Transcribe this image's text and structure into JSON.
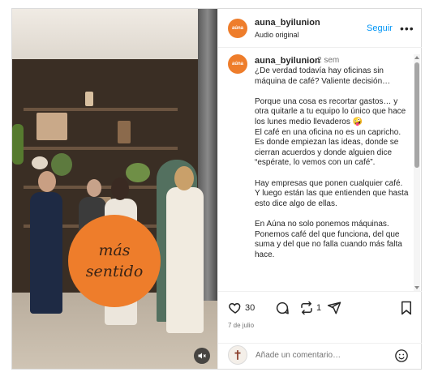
{
  "header": {
    "avatar_text": "aúna",
    "username": "auna_byilunion",
    "subtitle": "Audio original",
    "follow_label": "Seguir",
    "more_label": "•••"
  },
  "caption": {
    "username": "auna_byilunion",
    "time": "2 sem",
    "text": "¿De verdad todavía hay oficinas sin máquina de café? Valiente decisión…\n\nPorque una cosa es recortar gastos… y otra quitarle a tu equipo lo único que hace los lunes medio llevaderos 🤪\nEl café en una oficina no es un capricho. Es donde empiezan las ideas, donde se cierran acuerdos y donde alguien dice “espérate, lo vemos con un café”.\n\nHay empresas que ponen cualquier café. Y luego están las que entienden que hasta esto dice algo de ellas.\n\nEn Aúna no solo ponemos máquinas. Ponemos café del que funciona, del que suma y del que no falla cuando más falta hace."
  },
  "media": {
    "overlay_line1": "más",
    "overlay_line2": "sentido",
    "accent_color": "#ee7d2b"
  },
  "actions": {
    "likes": "30",
    "reposts": "1",
    "date": "7 de julio"
  },
  "add_comment": {
    "placeholder": "Añade un comentario…"
  },
  "colors": {
    "link": "#0095f6",
    "muted": "#737373",
    "text": "#262626"
  }
}
